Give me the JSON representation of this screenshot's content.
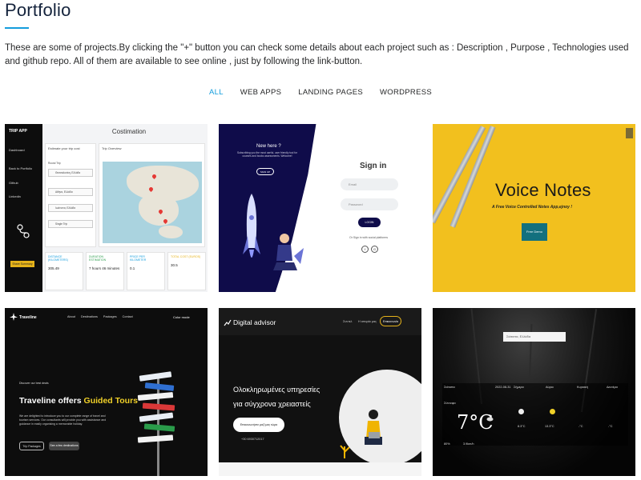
{
  "section": {
    "title": "Portfolio",
    "intro": "These are some of projects.By clicking the \"+\" button you can check some details about each project such as : Description , Purpose , Technologies used and github repo. All of them are available to see online , just by following the link-button."
  },
  "filters": [
    {
      "label": "ALL",
      "active": true
    },
    {
      "label": "WEB APPS",
      "active": false
    },
    {
      "label": "LANDING PAGES",
      "active": false
    },
    {
      "label": "WORDPRESS",
      "active": false
    }
  ],
  "colors": {
    "accent": "#149ddd",
    "heading": "#14233c",
    "voice_notes_bg": "#f2c01e"
  },
  "projects": {
    "costimation": {
      "logo": "TRIP APP",
      "title": "Costimation",
      "nav": [
        "Dashboard",
        "Back to Portfolio",
        "Github",
        "Linkedin"
      ],
      "panel_left_title": "Estimate your trip cost",
      "panel_right_title": "Trip Overview",
      "options": [
        "Round Trip",
        "Single Trip"
      ],
      "cities": [
        "Θεσσαλονίκη, Ελλάδα",
        "Αθήνα, Ελλάδα",
        "Ιωάννινα, Ελλάδα",
        "Single Trip"
      ],
      "stats": [
        {
          "label": "DISTANCE (KILOMETERS)",
          "value": "305.49"
        },
        {
          "label": "DURATION ESTIMATION",
          "value": "7 hours 46 minutes"
        },
        {
          "label": "PRICE PER KILOMETER",
          "value": "0.1"
        },
        {
          "label": "TOTAL COST (EUROS)",
          "value": "30.5"
        }
      ],
      "button": "Share Summary"
    },
    "signin": {
      "left_title": "New here ?",
      "left_text": "Subscribing you the most useful, user friendly tool for courses and books assessments. Welcome!",
      "signup": "SIGN UP",
      "title": "Sign in",
      "email_placeholder": "Email",
      "password_placeholder": "Password",
      "login": "LOGIN",
      "social": "Or Sign in with social platforms",
      "social_icons": [
        "f",
        "G"
      ]
    },
    "voice_notes": {
      "title": "Voice Notes",
      "subtitle": "A Free Voice Controlled Notes App,ejnoy !",
      "button": "Free Demo"
    },
    "traveline": {
      "logo": "Traveline",
      "nav": "About Destinations Packages Contact",
      "mode": "Color mode",
      "small": "Discover our best deals",
      "headline": "Traveline offers",
      "headline_accent": "Guided Tours",
      "paragraph": "We are delighted to introduce you to our complete range of travel and tourism services. Our consultants will provide you with assistance and guidance in easily organising a memorable holiday.",
      "btn1": "Trip Packages",
      "btn2": "See a few destinations"
    },
    "digital_advisor": {
      "logo": "Digital advisor",
      "nav1": "Συντελ",
      "nav2": "Η ιστορία μας",
      "button": "Επικοινωνία",
      "headline1": "Ολοκληρωμένες υπηρεσίες",
      "headline2": "για σύγχρονα χρειαστείς",
      "cta": "Επικοινωνήστε μαζί μας τώρα",
      "phone": "+30 6930712017"
    },
    "weather": {
      "search": "Σιάτιστα, Ελλάδα",
      "city": "Σιάτιστα",
      "date": "2022-08-31",
      "cond": "Σύννεφα",
      "temp": "7°C",
      "days": [
        "Σήμερα",
        "Αύριο",
        "Κυριακή",
        "Δευτέρα"
      ],
      "temps": [
        "8.3°C",
        "13.3°C",
        "-°C",
        "-°C"
      ],
      "humidity": "80%",
      "wind": "3.9km/h"
    }
  }
}
